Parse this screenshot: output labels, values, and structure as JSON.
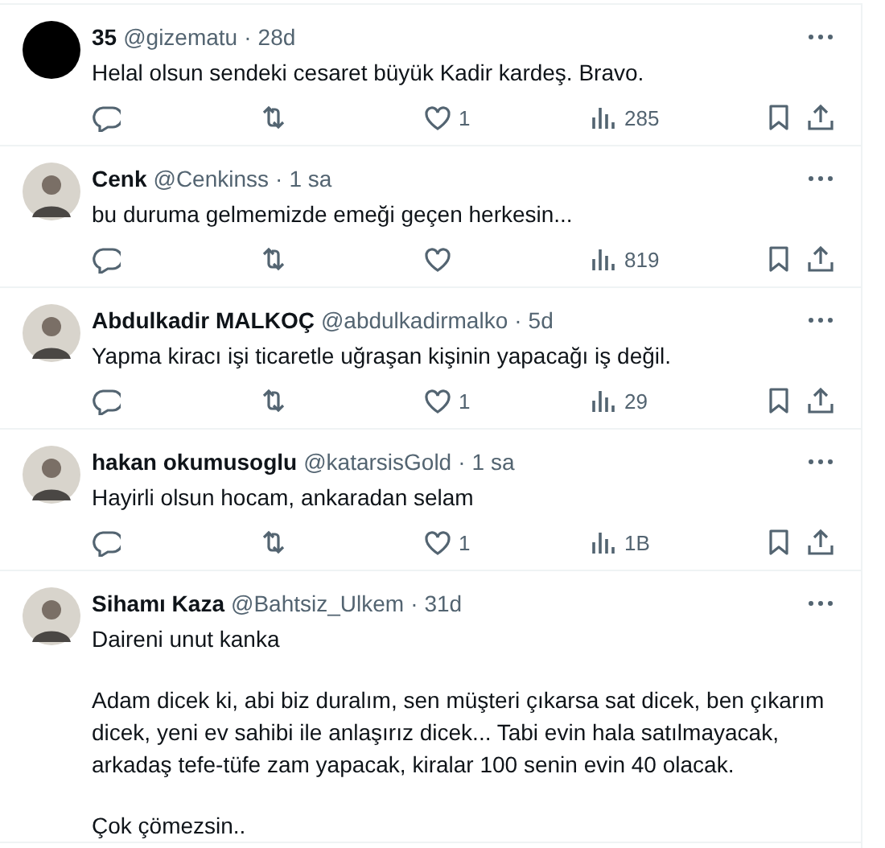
{
  "replies": [
    {
      "avatar": {
        "kind": "blank"
      },
      "name": "35",
      "handle": "@gizematu",
      "separator": "·",
      "time": "28d",
      "paragraphs": [
        "Helal olsun sendeki cesaret büyük Kadir kardeş. Bravo."
      ],
      "actions": {
        "likes": "1",
        "views": "285"
      }
    },
    {
      "name": "Cenk",
      "handle": "@Cenkinss",
      "separator": "·",
      "time": "1 sa",
      "paragraphs": [
        "bu duruma gelmemizde emeği geçen herkesin..."
      ],
      "actions": {
        "views": "819"
      }
    },
    {
      "name": "Abdulkadir MALKOÇ",
      "handle": "@abdulkadirmalko",
      "separator": "·",
      "time": "5d",
      "paragraphs": [
        "Yapma kiracı işi ticaretle uğraşan kişinin yapacağı iş değil."
      ],
      "actions": {
        "likes": "1",
        "views": "29"
      }
    },
    {
      "name": "hakan okumusoglu",
      "handle": "@katarsisGold",
      "separator": "·",
      "time": "1 sa",
      "paragraphs": [
        "Hayirli olsun hocam, ankaradan selam"
      ],
      "actions": {
        "likes": "1",
        "views": "1B"
      }
    },
    {
      "name": "Sihamı Kaza",
      "handle": "@Bahtsiz_Ulkem",
      "separator": "·",
      "time": "31d",
      "paragraphs": [
        "Daireni unut kanka",
        "Adam dicek ki, abi biz duralım, sen müşteri çıkarsa sat dicek, ben çıkarım dicek, yeni ev sahibi ile anlaşırız dicek... Tabi evin hala satılmayacak, arkadaş tefe-tüfe zam yapacak, kiralar 100 senin evin 40 olacak.",
        "Çok çömezsin.."
      ]
    }
  ]
}
